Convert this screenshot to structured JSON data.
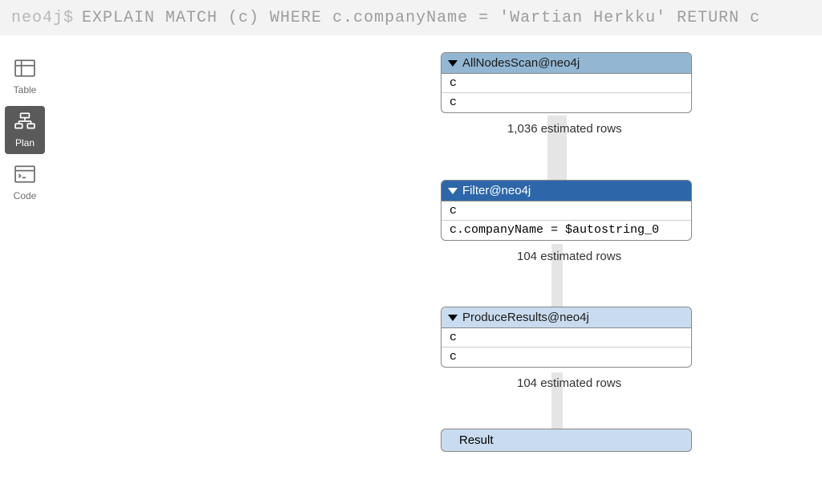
{
  "prompt": "neo4j$",
  "query": "EXPLAIN MATCH (c) WHERE c.companyName = 'Wartian Herkku' RETURN c",
  "sidebar": {
    "items": [
      {
        "label": "Table"
      },
      {
        "label": "Plan"
      },
      {
        "label": "Code"
      }
    ]
  },
  "plan": {
    "nodes": [
      {
        "title": "AllNodesScan@neo4j",
        "rows": [
          "c",
          "c"
        ],
        "estimated": "1,036 estimated rows",
        "header_bg": "#93b7d3",
        "header_fg": "#1b1b1b"
      },
      {
        "title": "Filter@neo4j",
        "rows": [
          "c",
          "c.companyName = $autostring_0"
        ],
        "estimated": "104 estimated rows",
        "header_bg": "#2d67a9",
        "header_fg": "#ffffff"
      },
      {
        "title": "ProduceResults@neo4j",
        "rows": [
          "c",
          "c"
        ],
        "estimated": "104 estimated rows",
        "header_bg": "#c9dcef",
        "header_fg": "#1b1b1b"
      }
    ],
    "result": {
      "label": "Result",
      "bg": "#c9dcef"
    }
  }
}
